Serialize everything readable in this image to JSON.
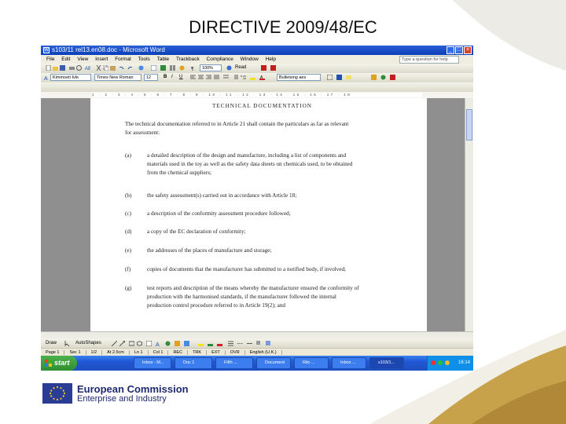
{
  "slide": {
    "title": "DIRECTIVE 2009/48/EC"
  },
  "window": {
    "title": "s103/11 rel13.en08.doc - Microsoft Word",
    "controls": [
      "_",
      "□",
      "×"
    ]
  },
  "menu": {
    "items": [
      "File",
      "Edit",
      "View",
      "Insert",
      "Format",
      "Tools",
      "Table",
      "Trackback",
      "Compliance",
      "Window",
      "Help"
    ],
    "help_placeholder": "Type a question for help"
  },
  "toolbar_standard": {
    "zoom": "100%",
    "read_label": "Read"
  },
  "toolbar_formatting": {
    "style": "Kimmoeti Ivle",
    "font": "Times New Roman",
    "size": "12",
    "bold": "B",
    "italic": "I",
    "underline": "U",
    "style2": "Bulletsing aes"
  },
  "ruler": {
    "ticks": "1 · 2 · 3 · 4 · 5 · 6 · 7 · 8 · 9 · 10 · 11 · 12 · 13 · 14 · 15 · 16 · 17 · 18"
  },
  "document": {
    "heading": "TECHNICAL DOCUMENTATION",
    "intro": [
      "The technical documentation referred to in Article 21 shall contain the particulars as far as relevant",
      "for assessment:"
    ],
    "items": [
      {
        "marker": "(a)",
        "lines": [
          "a detailed description of the design and manufacture, including a list of components and",
          "materials used in the toy as well as the safety data sheets on chemicals used, to be obtained",
          "from the chemical suppliers;"
        ]
      },
      {
        "marker": "(b)",
        "lines": [
          "the safety assessment(s) carried out in accordance with Article 18;"
        ]
      },
      {
        "marker": "(c)",
        "lines": [
          "a description of the conformity assessment procedure followed;"
        ]
      },
      {
        "marker": "(d)",
        "lines": [
          "a copy of the EC declaration of conformity;"
        ]
      },
      {
        "marker": "(e)",
        "lines": [
          "the addresses of the places of manufacture and storage;"
        ]
      },
      {
        "marker": "(f)",
        "lines": [
          "copies of documents that the manufacturer has submitted to a notified body, if involved;"
        ]
      },
      {
        "marker": "(g)",
        "lines": [
          "test reports and description of the means whereby the manufacturer ensured the conformity of",
          "production with the harmonised standards, if the manufacturer followed the internal",
          "production control procedure referred to in Article 19(2); and"
        ]
      }
    ]
  },
  "drawing": {
    "draw_label": "Draw",
    "autoshapes_label": "AutoShapes"
  },
  "status": {
    "page": "Page 1",
    "sec": "Sec 1",
    "pos": "1/2",
    "at": "At 2.5cm",
    "ln": "Ln 1",
    "col": "Col 1",
    "rec": "REC",
    "trk": "TRK",
    "ext": "EXT",
    "ovr": "OVR",
    "lang": "English (U.K.)"
  },
  "taskbar": {
    "start_label": "start",
    "buttons": [
      "Inbox - M...",
      "Doc 1",
      "Fifth ...",
      "Document",
      "Rilo ...",
      "Inbox ...",
      "s103/1..."
    ],
    "clock": "16:14"
  },
  "logo": {
    "line1": "European Commission",
    "line2": "Enterprise and Industry"
  },
  "colors": {
    "xp_blue": "#2157d4",
    "start_green": "#3a9a3a",
    "eu_blue": "#2a3c94",
    "deco_tan": "#c8a24a"
  }
}
